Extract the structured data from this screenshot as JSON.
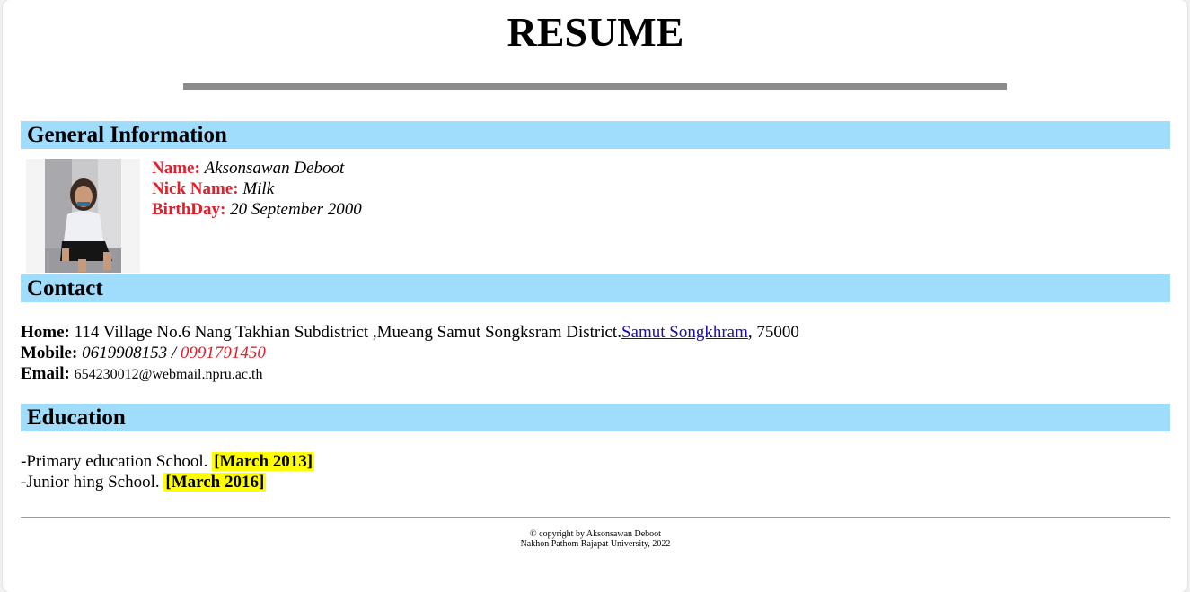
{
  "header": {
    "title": "RESUME"
  },
  "sections": {
    "general": "General Information",
    "contact": "Contact",
    "education": "Education"
  },
  "general": {
    "name_label": "Name:",
    "name_value": "Aksonsawan Deboot",
    "nick_label": "Nick Name:",
    "nick_value": "Milk",
    "birth_label": "BirthDay:",
    "birth_value": "20 September 2000"
  },
  "contact": {
    "home_label": "Home:",
    "home_value": "114 Village No.6 Nang Takhian Subdistrict ,Mueang Samut Songksram District.",
    "home_link": "Samut Songkhram",
    "home_postal": ", 75000",
    "mobile_label": "Mobile:",
    "mobile_value": "0619908153 / ",
    "mobile_old": "0991791450",
    "email_label": "Email:",
    "email_value": "654230012@webmail.npru.ac.th"
  },
  "education": {
    "items": [
      {
        "text": "-Primary education School. ",
        "date": "[March 2013]"
      },
      {
        "text": "-Junior hing School. ",
        "date": "[March 2016]"
      }
    ]
  },
  "footer": {
    "line1": "© copyright by Aksonsawan Deboot",
    "line2": "Nakhon Pathom Rajapat University, 2022"
  },
  "colors": {
    "section_bar": "#a0dcfc",
    "label_red": "#e0202c",
    "highlight": "#ffff00",
    "link": "#1a0dab"
  }
}
